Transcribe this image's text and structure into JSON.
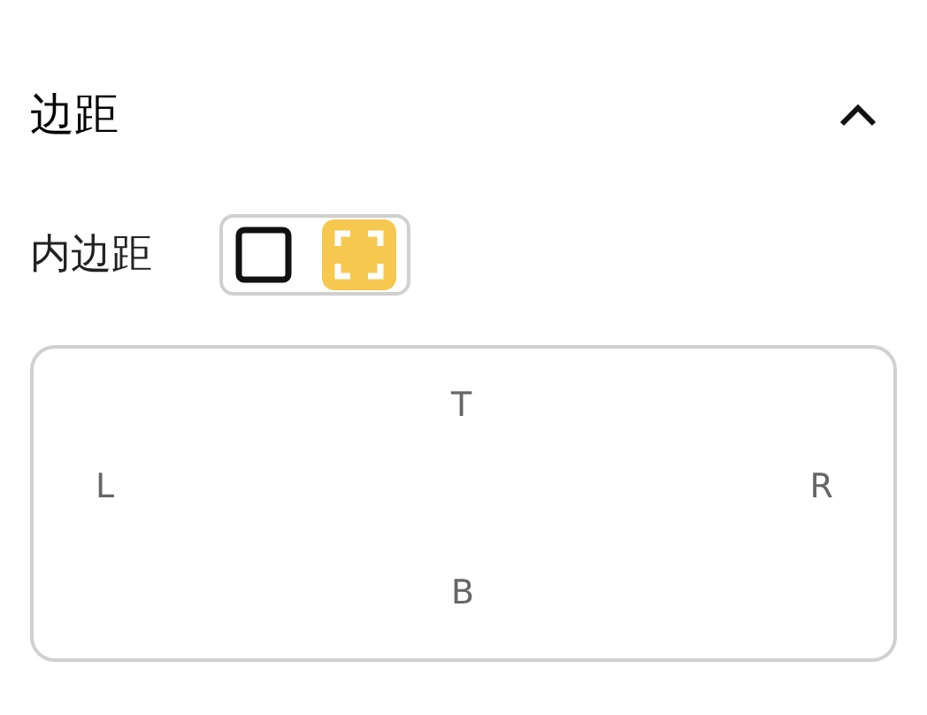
{
  "section": {
    "title": "边距",
    "expanded": true
  },
  "padding": {
    "label": "内边距",
    "modes": [
      {
        "kind": "uniform",
        "selected": false
      },
      {
        "kind": "individual",
        "selected": true
      }
    ]
  },
  "sides": {
    "top": "T",
    "left": "L",
    "right": "R",
    "bottom": "B"
  }
}
